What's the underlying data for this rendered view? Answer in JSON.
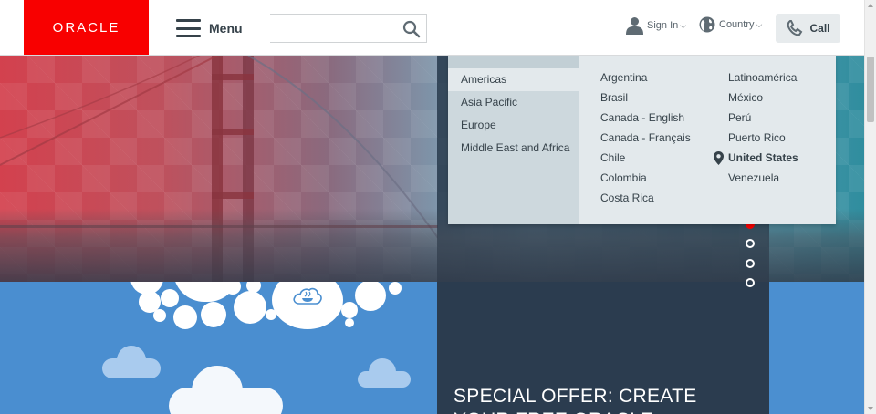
{
  "brand": {
    "logo_text": "ORACLE"
  },
  "header": {
    "menu_label": "Menu",
    "search_placeholder": "",
    "sign_in_label": "Sign In",
    "country_label": "Country",
    "call_label": "Call"
  },
  "country_dropdown": {
    "regions": [
      "Americas",
      "Asia Pacific",
      "Europe",
      "Middle East and Africa"
    ],
    "active_region": "Americas",
    "countries_col1": [
      "Argentina",
      "Brasil",
      "Canada - English",
      "Canada - Français",
      "Chile",
      "Colombia",
      "Costa Rica"
    ],
    "countries_col2": [
      "Latinoamérica",
      "México",
      "Perú",
      "Puerto Rico",
      "United States",
      "Venezuela"
    ],
    "selected_country": "United States"
  },
  "carousel": {
    "slide_count": 4,
    "active_index": 0
  },
  "promo": {
    "title": "SPECIAL OFFER: CREATE YOUR FREE ORACLE"
  },
  "colors": {
    "brand_red": "#f80000",
    "text_dark": "#36424a",
    "dropdown_bg": "#e3e9ec",
    "promo_bg": "#2b3c4f",
    "sky_blue": "#4b8fd0"
  }
}
